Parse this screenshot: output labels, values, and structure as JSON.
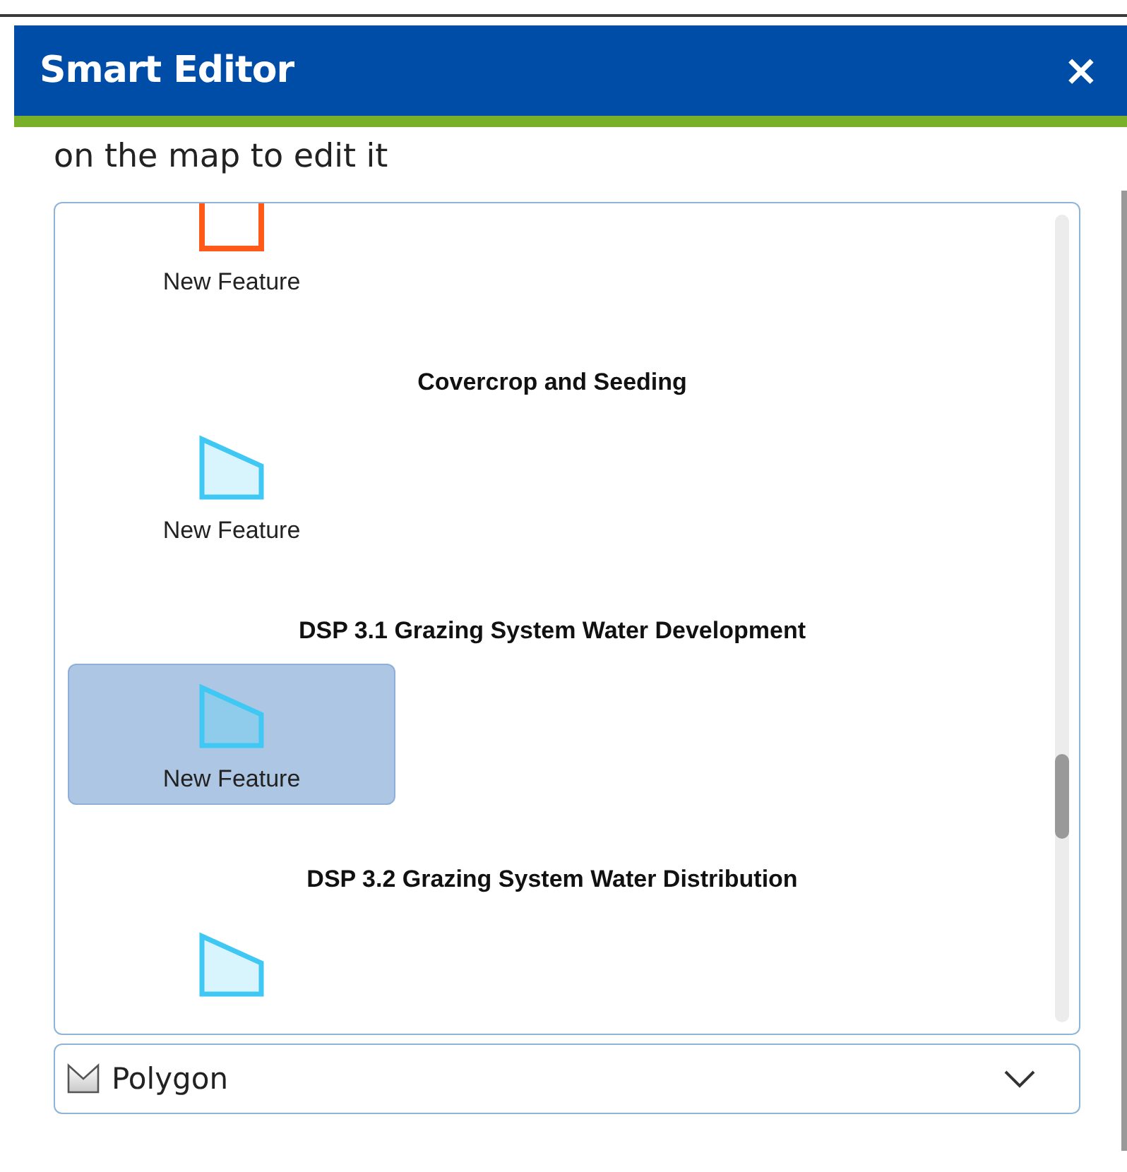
{
  "panel": {
    "title": "Smart Editor",
    "close": "×"
  },
  "instruction": "on the map to edit it",
  "template_groups": [
    {
      "items": [
        {
          "label": "New Feature",
          "color": "#ff5a1a",
          "selected": false
        }
      ]
    },
    {
      "heading": "Covercrop and Seeding",
      "items": [
        {
          "label": "New Feature",
          "color": "#40c8f4",
          "selected": false
        }
      ]
    },
    {
      "heading": "DSP 3.1 Grazing System Water Development",
      "items": [
        {
          "label": "New Feature",
          "color": "#40c8f4",
          "selected": true
        }
      ]
    },
    {
      "heading": "DSP 3.2 Grazing System Water Distribution",
      "items": [
        {
          "color": "#40c8f4",
          "selected": false
        }
      ]
    }
  ],
  "filter": {
    "value": "Polygon"
  }
}
